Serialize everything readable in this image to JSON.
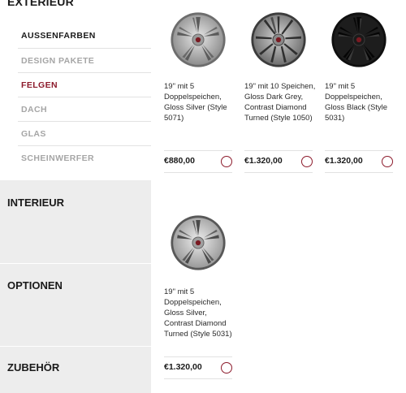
{
  "sidebar": {
    "exterior_title": "EXTERIEUR",
    "sub_items": [
      {
        "label": "AUSSENFARBEN",
        "state": "visited"
      },
      {
        "label": "DESIGN PAKETE",
        "state": "inactive"
      },
      {
        "label": "FELGEN",
        "state": "active"
      },
      {
        "label": "DACH",
        "state": "inactive"
      },
      {
        "label": "GLAS",
        "state": "inactive"
      },
      {
        "label": "SCHEINWERFER",
        "state": "inactive"
      }
    ],
    "categories": [
      "INTERIEUR",
      "OPTIONEN",
      "ZUBEHÖR"
    ]
  },
  "wheels": [
    {
      "description": "19\" mit 5 Doppelspeichen, Gloss Silver (Style 5071)",
      "price": "€880,00",
      "finish": "silver-icon"
    },
    {
      "description": "19\" mit 10 Speichen, Gloss Dark Grey, Contrast Diamond Turned (Style 1050)",
      "price": "€1.320,00",
      "finish": "dark-grey-icon"
    },
    {
      "description": "19\" mit 5 Doppelspeichen, Gloss Black (Style 5031)",
      "price": "€1.320,00",
      "finish": "black-icon"
    },
    {
      "description": "19\" mit 5 Doppelspeichen, Gloss Silver, Contrast Diamond Turned (Style 5031)",
      "price": "€1.320,00",
      "finish": "silver-icon"
    }
  ],
  "colors": {
    "accent": "#8c1a2b",
    "sidebar_bg": "#ededed",
    "muted_text": "#a6a6a6"
  }
}
